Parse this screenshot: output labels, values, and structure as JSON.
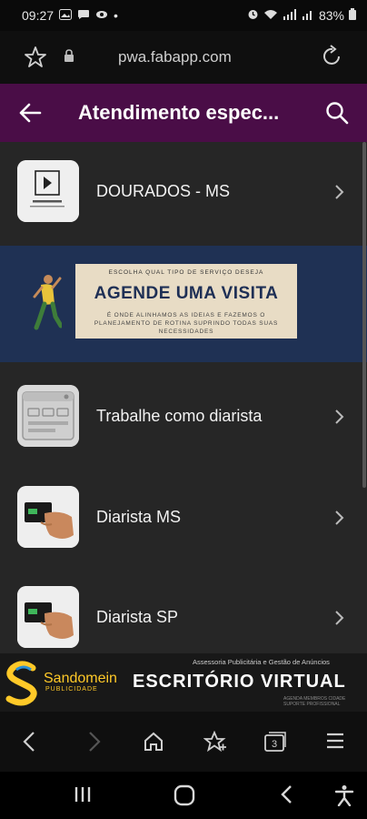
{
  "status_bar": {
    "time": "09:27",
    "battery": "83%",
    "bullet": "•"
  },
  "browser": {
    "url": "pwa.fabapp.com"
  },
  "header": {
    "title": "Atendimento espec..."
  },
  "list": {
    "items": [
      {
        "label": "DOURADOS - MS"
      },
      {
        "label": "Trabalhe como diarista"
      },
      {
        "label": "Diarista MS"
      },
      {
        "label": "Diarista SP"
      }
    ]
  },
  "banner": {
    "subtitle": "ESCOLHA QUAL TIPO DE SERVIÇO DESEJA",
    "title": "AGENDE UMA VISITA",
    "description": "É ONDE ALINHAMOS AS IDEIAS E FAZEMOS O PLANEJAMENTO DE ROTINA SUPRINDO TODAS SUAS NECESSIDADES"
  },
  "ad": {
    "brand": "Sandomein",
    "brand_sub": "PUBLICIDADE",
    "small_text": "Assessoria Publicitária e Gestão de Anúncios",
    "title": "ESCRITÓRIO VIRTUAL",
    "tagline": "AGENDA MEMBROS CIDADE SUPORTE PROFISSIONAL"
  },
  "colors": {
    "header_bg": "#4a0d47",
    "content_bg": "#262626",
    "banner_bg": "#1f3154",
    "ad_accent": "#ffc928"
  }
}
